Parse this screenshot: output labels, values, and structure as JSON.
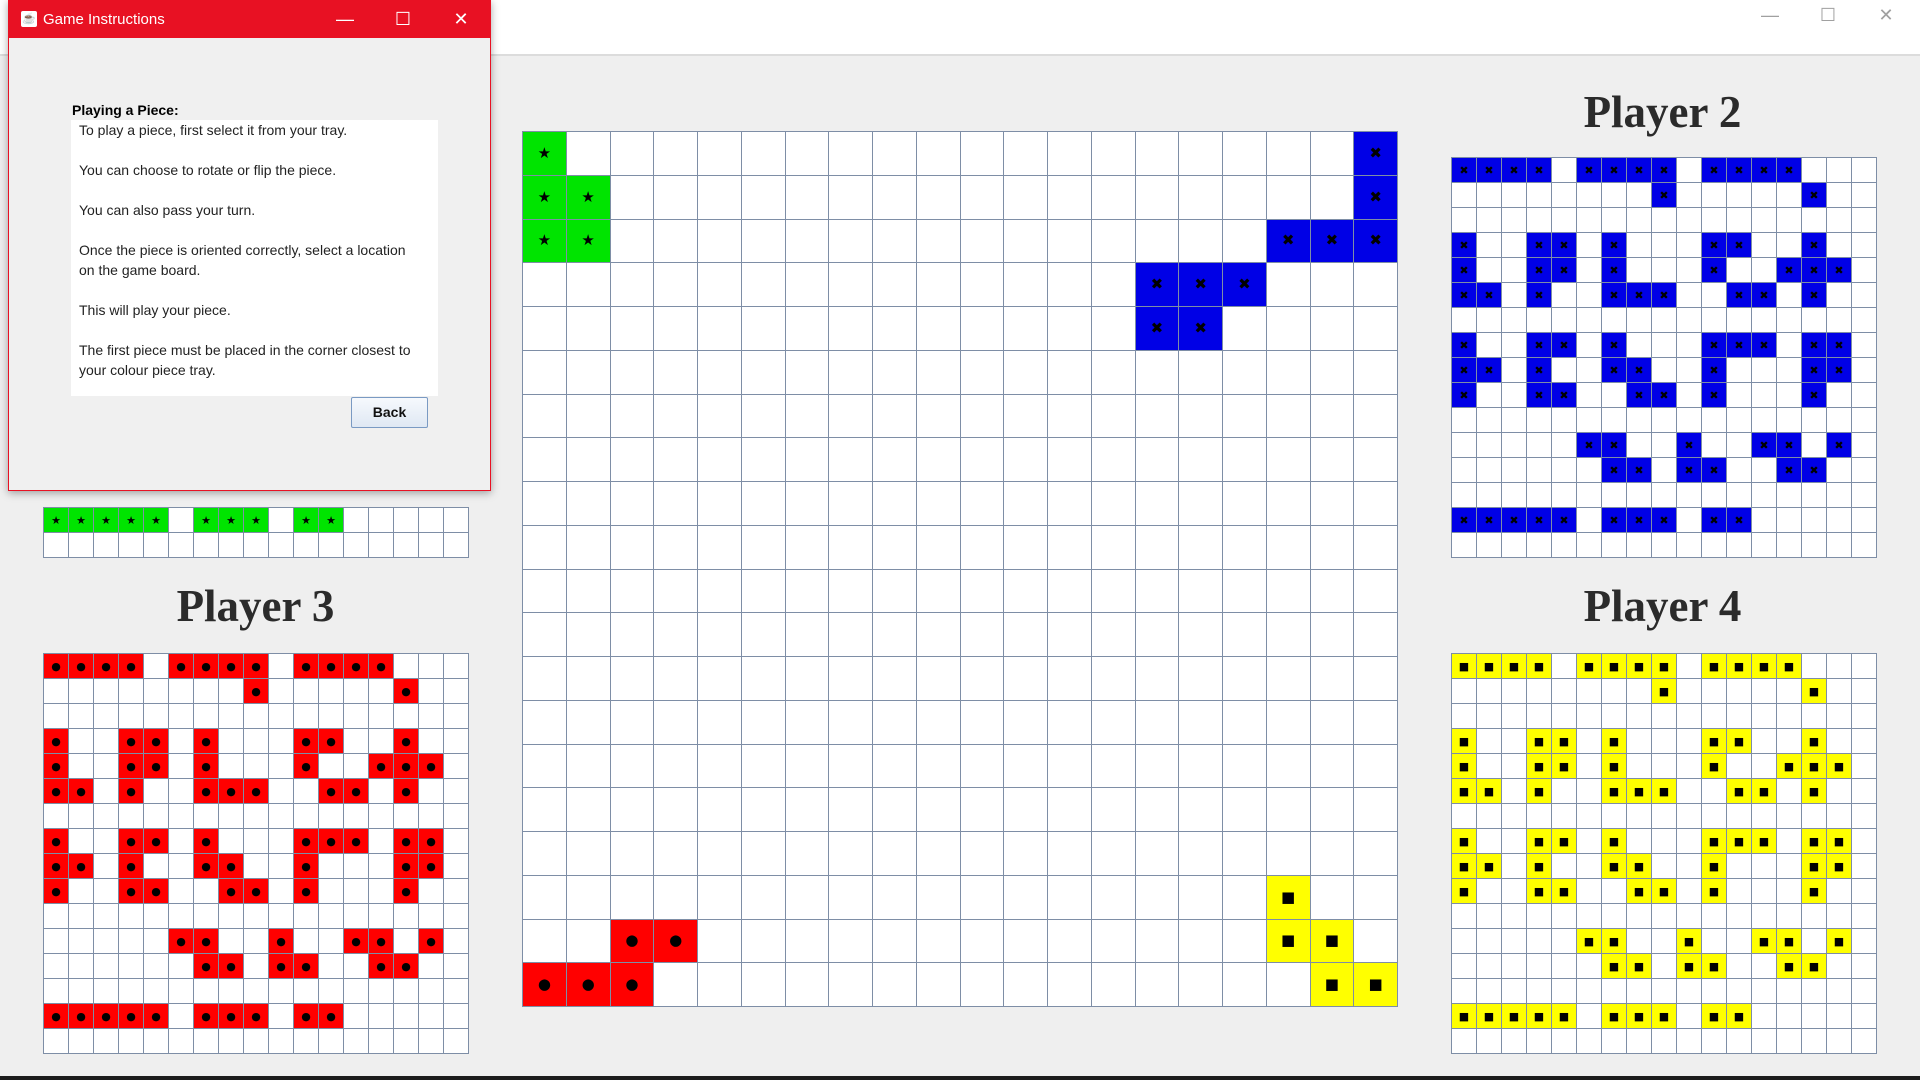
{
  "window": {
    "controls": {
      "minimize": "—",
      "maximize": "☐",
      "close": "✕"
    }
  },
  "dialog": {
    "title": "Game Instructions",
    "controls": {
      "minimize": "—",
      "maximize": "☐",
      "close": "✕"
    },
    "heading": "Playing a Piece:",
    "lines": [
      "To play a piece, first select it from your tray.",
      "You can choose to rotate or flip the piece.",
      "You can also pass your turn.",
      "Once the piece is oriented correctly, select a location",
      "on the game board.",
      "This will play your piece.",
      "The first piece must be placed in the corner closest to",
      "your colour piece tray."
    ],
    "back_label": "Back"
  },
  "players": {
    "p2": "Player 2",
    "p3": "Player 3",
    "p4": "Player 4"
  },
  "colors": {
    "green": "#00e400",
    "blue": "#0000e6",
    "red": "#ff0000",
    "yellow": "#ffff00",
    "grid_line": "#7e8ea6"
  },
  "symbols": {
    "green": "★",
    "blue": "✖",
    "red": "●",
    "yellow": "■"
  },
  "board": {
    "rows": 20,
    "cols": 20,
    "pieces": [
      {
        "color": "green",
        "cells": [
          [
            0,
            0
          ],
          [
            1,
            0
          ],
          [
            1,
            1
          ],
          [
            2,
            0
          ],
          [
            2,
            1
          ]
        ]
      },
      {
        "color": "blue",
        "cells": [
          [
            0,
            19
          ],
          [
            1,
            19
          ],
          [
            2,
            17
          ],
          [
            2,
            18
          ],
          [
            2,
            19
          ],
          [
            3,
            14
          ],
          [
            3,
            15
          ],
          [
            3,
            16
          ],
          [
            4,
            14
          ],
          [
            4,
            15
          ]
        ]
      },
      {
        "color": "red",
        "cells": [
          [
            18,
            2
          ],
          [
            18,
            3
          ],
          [
            19,
            0
          ],
          [
            19,
            1
          ],
          [
            19,
            2
          ]
        ]
      },
      {
        "color": "yellow",
        "cells": [
          [
            17,
            17
          ],
          [
            18,
            17
          ],
          [
            18,
            18
          ],
          [
            19,
            18
          ],
          [
            19,
            19
          ]
        ]
      }
    ]
  },
  "trays": {
    "green_visible_rows": [
      [
        1,
        1,
        1,
        1,
        1,
        0,
        1,
        1,
        1,
        0,
        1,
        1,
        0,
        0,
        0,
        0,
        0
      ],
      [
        0,
        0,
        0,
        0,
        0,
        0,
        0,
        0,
        0,
        0,
        0,
        0,
        0,
        0,
        0,
        0,
        0
      ]
    ],
    "pattern": [
      "1111.1111.1111..",
      "........1.....1.",
      ".................",
      "1..11.1...11..1.",
      "1..11.1...1..111",
      "11.1..111..11.1.",
      ".................",
      "1..11.1...111.11",
      "11.1..11..1...11",
      "1..11..11.1...1.",
      ".................",
      ".....11..1..11.1",
      "......11.11..11.",
      ".................",
      "11111.111.11...."
    ]
  }
}
